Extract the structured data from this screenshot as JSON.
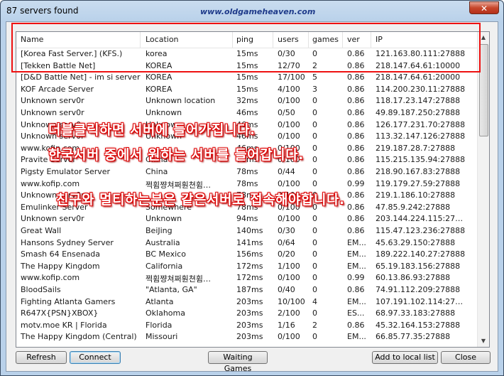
{
  "window": {
    "title": "87 servers found",
    "watermark": "www.oldgameheaven.com",
    "close_glyph": "✕"
  },
  "columns": [
    "Name",
    "Location",
    "ping",
    "users",
    "games",
    "ver",
    "IP"
  ],
  "rows": [
    [
      "[Korea Fast Server.] (KFS.)",
      "korea",
      "15ms",
      "0/30",
      "0",
      "0.86",
      "121.163.80.111:27888"
    ],
    [
      "[Tekken Battle Net]",
      "KOREA",
      "15ms",
      "12/70",
      "2",
      "0.86",
      "218.147.64.61:10000"
    ],
    [
      "[D&D Battle Net] - im si server",
      "KOREA",
      "15ms",
      "17/100",
      "5",
      "0.86",
      "218.147.64.61:20000"
    ],
    [
      "KOF Arcade Server",
      "KOREA",
      "15ms",
      "4/100",
      "3",
      "0.86",
      "114.200.230.11:27888"
    ],
    [
      "Unknown serv0r",
      "Unknown location",
      "32ms",
      "0/100",
      "0",
      "0.86",
      "118.17.23.147:27888"
    ],
    [
      "Unknown serv0r",
      "Unknown",
      "46ms",
      "0/50",
      "0",
      "0.86",
      "49.89.187.250:27888"
    ],
    [
      "Unknown serv0r",
      "Unknown",
      "46ms",
      "0/100",
      "0",
      "0.86",
      "126.177.231.70:27888"
    ],
    [
      "Unknown serv0r",
      "Unknown",
      "46ms",
      "0/100",
      "0",
      "0.86",
      "113.32.147.126:27888"
    ],
    [
      "www.kofip.com",
      "",
      "46ms",
      "0/100",
      "0",
      "0.86",
      "219.187.28.7:27888"
    ],
    [
      "Pravite Server",
      "China",
      "78ms",
      "0/100",
      "0",
      "0.86",
      "115.215.135.94:27888"
    ],
    [
      "Pigsty Emulator Server",
      "China",
      "78ms",
      "0/44",
      "0",
      "0.86",
      "218.90.167.83:27888"
    ],
    [
      "www.kofip.com",
      "쩍휨쨩쳐쩌훤쳔휨…",
      "78ms",
      "0/100",
      "0",
      "0.99",
      "119.179.27.59:27888"
    ],
    [
      "Unknown serv0r",
      "",
      "78ms",
      "0/100",
      "0",
      "0.86",
      "219.1.186.10:27888"
    ],
    [
      "Emulinker Server",
      "Somewhere",
      "78ms",
      "0/100",
      "0",
      "0.86",
      "47.85.9.242:27888"
    ],
    [
      "Unknown serv0r",
      "Unknown",
      "94ms",
      "0/100",
      "0",
      "0.86",
      "203.144.224.115:27…"
    ],
    [
      "Great Wall",
      "BeiJing",
      "140ms",
      "0/30",
      "0",
      "0.86",
      "115.47.123.236:27888"
    ],
    [
      "Hansons Sydney Server",
      "Australia",
      "141ms",
      "0/64",
      "0",
      "EM...",
      "45.63.29.150:27888"
    ],
    [
      "Smash 64 Ensenada",
      "BC Mexico",
      "156ms",
      "0/20",
      "0",
      "EM...",
      "189.222.140.27:27888"
    ],
    [
      "The Happy Kingdom",
      "California",
      "172ms",
      "1/100",
      "0",
      "EM...",
      "65.19.183.156:27888"
    ],
    [
      "www.kofip.com",
      "쩍휨쨩쳐쩌훤쳔휨…",
      "172ms",
      "0/100",
      "0",
      "0.99",
      "60.13.86.93:27888"
    ],
    [
      "BloodSails",
      "\"Atlanta, GA\"",
      "187ms",
      "0/40",
      "0",
      "0.86",
      "74.91.112.209:27888"
    ],
    [
      "Fighting Atlanta Gamers",
      "Atlanta",
      "203ms",
      "10/100",
      "4",
      "EM...",
      "107.191.102.114:27…"
    ],
    [
      "R647X{PSN}XBOX}",
      "Oklahoma",
      "203ms",
      "2/100",
      "0",
      "ES...",
      "68.97.33.183:27888"
    ],
    [
      "motv.moe KR | Florida",
      "Florida",
      "203ms",
      "1/16",
      "2",
      "0.86",
      "45.32.164.153:27888"
    ],
    [
      "The Happy Kingdom (Central)",
      "Missouri",
      "203ms",
      "0/100",
      "0",
      "EM...",
      "66.85.77.35:27888"
    ]
  ],
  "overlay": {
    "line1": "더블클릭하면 서버에 들어가집니다.",
    "line2": "한국서버 중에서 원하는 서버를 들어갑니다.",
    "line3": "친구와 멀티하는분은 같은서버로 접속해야합니다."
  },
  "buttons": {
    "refresh": "Refresh",
    "connect": "Connect",
    "waiting_games": "Waiting Games",
    "add_to_local_list": "Add to local list",
    "close": "Close"
  },
  "scrollbar": {
    "up_glyph": "▲",
    "down_glyph": "▼"
  },
  "colors": {
    "highlight": "#e11111",
    "overlay_outline": "#dd0000"
  }
}
